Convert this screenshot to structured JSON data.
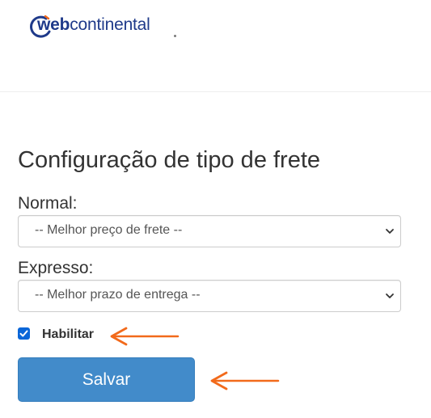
{
  "header": {
    "logo_web": "web",
    "logo_rest": "continental"
  },
  "form": {
    "title": "Configuração de tipo de frete",
    "normal_label": "Normal:",
    "normal_value": "-- Melhor preço de frete --",
    "expresso_label": "Expresso:",
    "expresso_value": "-- Melhor prazo de entrega --",
    "habilitar_label": "Habilitar",
    "habilitar_checked": true,
    "save_label": "Salvar"
  },
  "annotations": {
    "arrow_color": "#f26a1b"
  },
  "colors": {
    "brand": "#1f3a8a",
    "button": "#428bca",
    "checkbox": "#0a66d8"
  }
}
